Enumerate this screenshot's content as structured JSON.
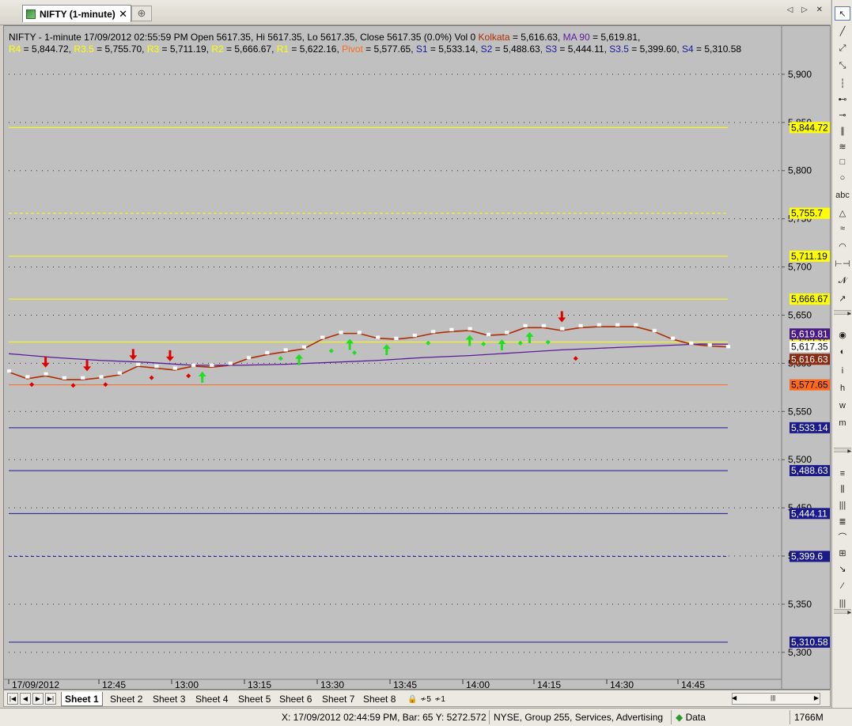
{
  "window": {
    "tab_title": "NIFTY (1-minute)",
    "tab_close": "✕",
    "new_tab": "⊕",
    "tab_nav": "◁ ▷ ✕"
  },
  "header": {
    "line1": [
      {
        "text": "NIFTY - 1-minute 17/09/2012 02:55:59 PM Open 5617.35, Hi 5617.35, Lo 5617.35, Close 5617.35 (0.0%) Vol 0 ",
        "color": "#000000"
      },
      {
        "text": "Kolkata",
        "color": "#b02a00"
      },
      {
        "text": " = 5,616.63, ",
        "color": "#000000"
      },
      {
        "text": "MA 90",
        "color": "#5a1a9a"
      },
      {
        "text": " = 5,619.81,",
        "color": "#000000"
      }
    ],
    "line2": [
      {
        "text": "R4",
        "color": "#ffff00"
      },
      {
        "text": " = 5,844.72, ",
        "color": "#000000"
      },
      {
        "text": "R3.5",
        "color": "#ffff00"
      },
      {
        "text": " = 5,755.70, ",
        "color": "#000000"
      },
      {
        "text": "R3",
        "color": "#ffff00"
      },
      {
        "text": " = 5,711.19, ",
        "color": "#000000"
      },
      {
        "text": "R2",
        "color": "#ffff00"
      },
      {
        "text": " = 5,666.67, ",
        "color": "#000000"
      },
      {
        "text": "R1",
        "color": "#ffff00"
      },
      {
        "text": " = 5,622.16, ",
        "color": "#000000"
      },
      {
        "text": "Pivot",
        "color": "#ff6a1a"
      },
      {
        "text": " = 5,577.65, ",
        "color": "#000000"
      },
      {
        "text": "S1",
        "color": "#1a1a9a"
      },
      {
        "text": " = 5,533.14, ",
        "color": "#000000"
      },
      {
        "text": "S2",
        "color": "#1a1a9a"
      },
      {
        "text": " = 5,488.63, ",
        "color": "#000000"
      },
      {
        "text": "S3",
        "color": "#1a1a9a"
      },
      {
        "text": " = 5,444.11, ",
        "color": "#000000"
      },
      {
        "text": "S3.5",
        "color": "#1a1a9a"
      },
      {
        "text": " = 5,399.60, ",
        "color": "#000000"
      },
      {
        "text": "S4",
        "color": "#1a1a9a"
      },
      {
        "text": " = 5,310.58",
        "color": "#000000"
      }
    ]
  },
  "chart_data": {
    "type": "line",
    "ylim": [
      5272,
      5950
    ],
    "y_ticks": [
      "5,300",
      "5,350",
      "5,400",
      "5,450",
      "5,500",
      "5,550",
      "5,600",
      "5,650",
      "5,700",
      "5,750",
      "5,800",
      "5,850",
      "5,900"
    ],
    "y_tick_values": [
      5300,
      5350,
      5400,
      5450,
      5500,
      5550,
      5600,
      5650,
      5700,
      5750,
      5800,
      5850,
      5900
    ],
    "x_minutes_range": [
      0,
      116
    ],
    "x_ticks": [
      {
        "label": "17/09/2012",
        "minute": 0
      },
      {
        "label": "12:45",
        "minute": 10
      },
      {
        "label": "13:00",
        "minute": 25
      },
      {
        "label": "13:15",
        "minute": 40
      },
      {
        "label": "13:30",
        "minute": 55
      },
      {
        "label": "13:45",
        "minute": 70
      },
      {
        "label": "14:00",
        "minute": 85
      },
      {
        "label": "14:15",
        "minute": 100
      },
      {
        "label": "14:30",
        "minute": 115
      },
      {
        "label": "14:45",
        "minute": 130
      }
    ],
    "pivot_levels": [
      {
        "name": "R4",
        "value": 5844.72,
        "label": "5,844.72",
        "color": "#ffff00",
        "dash": "none",
        "label_bg": "#ffff00",
        "label_fg": "#000000"
      },
      {
        "name": "R3.5",
        "value": 5755.7,
        "label": "5,755.7",
        "color": "#ffff00",
        "dash": "dashed",
        "label_bg": "#ffff00",
        "label_fg": "#000000"
      },
      {
        "name": "R3",
        "value": 5711.19,
        "label": "5,711.19",
        "color": "#ffff00",
        "dash": "none",
        "label_bg": "#ffff00",
        "label_fg": "#000000"
      },
      {
        "name": "R2",
        "value": 5666.67,
        "label": "5,666.67",
        "color": "#ffff00",
        "dash": "none",
        "label_bg": "#ffff00",
        "label_fg": "#000000"
      },
      {
        "name": "R1",
        "value": 5622.16,
        "label": "5,622.16",
        "color": "#ffff00",
        "dash": "none",
        "label_bg": "#ffff00",
        "label_fg": "#000000"
      },
      {
        "name": "Pivot",
        "value": 5577.65,
        "label": "5,577.65",
        "color": "#ff6a1a",
        "dash": "none",
        "label_bg": "#ff6a1a",
        "label_fg": "#000000"
      },
      {
        "name": "S1",
        "value": 5533.14,
        "label": "5,533.14",
        "color": "#1a1a9a",
        "dash": "none",
        "label_bg": "#1a1a8a",
        "label_fg": "#ffffff"
      },
      {
        "name": "S2",
        "value": 5488.63,
        "label": "5,488.63",
        "color": "#1a1a9a",
        "dash": "none",
        "label_bg": "#1a1a8a",
        "label_fg": "#ffffff"
      },
      {
        "name": "S3",
        "value": 5444.11,
        "label": "5,444.11",
        "color": "#1a1a9a",
        "dash": "none",
        "label_bg": "#1a1a8a",
        "label_fg": "#ffffff"
      },
      {
        "name": "S3.5",
        "value": 5399.6,
        "label": "5,399.6",
        "color": "#1a1a9a",
        "dash": "dashed",
        "label_bg": "#1a1a8a",
        "label_fg": "#ffffff"
      },
      {
        "name": "S4",
        "value": 5310.58,
        "label": "5,310.58",
        "color": "#1a1a9a",
        "dash": "none",
        "label_bg": "#1a1a8a",
        "label_fg": "#ffffff"
      }
    ],
    "value_labels": [
      {
        "value": 5619.81,
        "label": "5,619.81",
        "bg": "#4a1a8a",
        "fg": "#ffffff"
      },
      {
        "value": 5617.35,
        "label": "5,617.35",
        "bg": "#ffffff",
        "fg": "#000000"
      },
      {
        "value": 5616.63,
        "label": "5,616.63",
        "bg": "#8a2a10",
        "fg": "#ffffff"
      }
    ],
    "series": [
      {
        "name": "Kolkata",
        "color": "#b02a00",
        "x": [
          0,
          4,
          8,
          12,
          16,
          20,
          24,
          28,
          32,
          36,
          40,
          44,
          48,
          52,
          56,
          60,
          64,
          68,
          72,
          76,
          80,
          84,
          88,
          92,
          96,
          100,
          104,
          108,
          112,
          116,
          120,
          124,
          128,
          132,
          136,
          140,
          144,
          148,
          152,
          156
        ],
        "values": [
          5591,
          5584,
          5587,
          5583,
          5583,
          5585,
          5588,
          5597,
          5595,
          5593,
          5597,
          5596,
          5598,
          5605,
          5609,
          5612,
          5615,
          5625,
          5631,
          5631,
          5626,
          5625,
          5627,
          5631,
          5633,
          5634,
          5629,
          5630,
          5637,
          5637,
          5634,
          5637,
          5638,
          5638,
          5638,
          5633,
          5625,
          5620,
          5618,
          5617
        ]
      },
      {
        "name": "MA 90",
        "color": "#5a1a9a",
        "x": [
          0,
          10,
          20,
          30,
          40,
          50,
          60,
          70,
          80,
          90,
          100,
          110,
          120,
          130,
          140,
          150,
          156
        ],
        "values": [
          5610,
          5606,
          5603,
          5601,
          5598,
          5598,
          5599,
          5601,
          5603,
          5606,
          5608,
          5611,
          5614,
          5616,
          5618,
          5620,
          5619.81
        ]
      },
      {
        "name": "Close",
        "color": "#ffffff",
        "x": [
          0,
          4,
          8,
          12,
          16,
          20,
          24,
          28,
          32,
          36,
          40,
          44,
          48,
          52,
          56,
          60,
          64,
          68,
          72,
          76,
          80,
          84,
          88,
          92,
          96,
          100,
          104,
          108,
          112,
          116,
          120,
          124,
          128,
          132,
          136,
          140,
          144,
          148,
          152,
          156
        ],
        "values": [
          5592,
          5586,
          5589,
          5585,
          5585,
          5586,
          5590,
          5599,
          5597,
          5595,
          5598,
          5598,
          5600,
          5606,
          5611,
          5614,
          5617,
          5627,
          5632,
          5632,
          5627,
          5626,
          5629,
          5633,
          5635,
          5636,
          5630,
          5632,
          5639,
          5639,
          5636,
          5639,
          5640,
          5640,
          5640,
          5634,
          5626,
          5621,
          5619,
          5617.35
        ]
      }
    ],
    "sell_arrows": [
      8,
      17,
      27,
      35,
      120
    ],
    "buy_arrows": [
      42,
      63,
      74,
      82,
      100,
      107,
      113
    ],
    "red_dots": [
      {
        "x": 5,
        "y": 5578
      },
      {
        "x": 14,
        "y": 5577
      },
      {
        "x": 21,
        "y": 5578
      },
      {
        "x": 31,
        "y": 5585
      },
      {
        "x": 39,
        "y": 5587
      },
      {
        "x": 123,
        "y": 5605
      }
    ],
    "green_dots": [
      {
        "x": 59,
        "y": 5605
      },
      {
        "x": 70,
        "y": 5613
      },
      {
        "x": 75,
        "y": 5611
      },
      {
        "x": 91,
        "y": 5621
      },
      {
        "x": 103,
        "y": 5620
      },
      {
        "x": 111,
        "y": 5621
      },
      {
        "x": 117,
        "y": 5622
      }
    ]
  },
  "toolbar_right": [
    "↖",
    "╱",
    "⤢",
    "⤡",
    "┆",
    "⊷",
    "⊸",
    "∥",
    "≋",
    "□",
    "○",
    "abc",
    "△",
    "≈",
    "◠",
    "⊢⊣",
    "𝓝",
    "↗",
    "◉",
    "◐",
    "i",
    "h",
    "w",
    "m",
    "≡",
    "⫼",
    "|||",
    "≣",
    "⌒",
    "⊞",
    "↘",
    "⁄",
    "|||"
  ],
  "sheets": {
    "tabs": [
      "Sheet 1",
      "Sheet 2",
      "Sheet 3",
      "Sheet 4",
      "Sheet 5",
      "Sheet 6",
      "Sheet 7",
      "Sheet 8"
    ],
    "active": 0,
    "nav": [
      "|◀",
      "◀",
      "▶",
      "▶|"
    ],
    "extra": [
      "🔒",
      "≁5",
      "≁1"
    ],
    "scroll_grip": "|||"
  },
  "status": {
    "cursor": "X: 17/09/2012 02:44:59 PM, Bar: 65  Y: 5272.572",
    "exchange": "NYSE, Group 255, Services, Advertising",
    "data": "Data",
    "memory": "1766M",
    "data_color": "#2a9a2a"
  }
}
